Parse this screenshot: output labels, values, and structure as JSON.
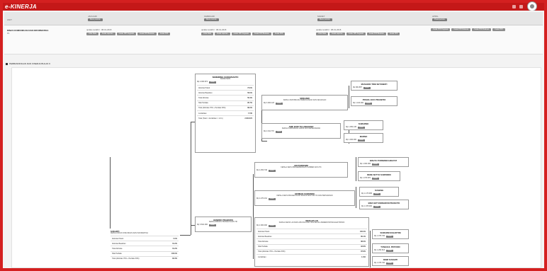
{
  "app": {
    "brand": "e-KINERJA"
  },
  "header": {
    "unit_label": "UNIT",
    "columns": [
      {
        "label": "JANUARI",
        "action": "Menu periode"
      },
      {
        "label": "FEBRUARI",
        "action": "Menu periode"
      },
      {
        "label": "MARET",
        "action": "Menu periode"
      },
      {
        "label": "APRIL",
        "action": "Pusat periode"
      }
    ]
  },
  "org": {
    "name": "DINAS KOMUNIKASI DAN INFORMATIKA",
    "sub": "P1",
    "columns": [
      {
        "updated": "update terakhir : 08-01-2018",
        "buttons": [
          "Lihat Data",
          "Cetak Laporan",
          "Cetak TPP Pegawai",
          "Cetak TPP Bulanan",
          "Cetak TPP"
        ]
      },
      {
        "updated": "update terakhir : 08-01-2018",
        "buttons": [
          "Lihat Data",
          "Cetak Laporan",
          "Cetak TPP Pegawai",
          "Cetak TPP Bulanan",
          "Cetak TPP"
        ]
      },
      {
        "updated": "update terakhir : 08-01-2018",
        "buttons": [
          "Lihat Data",
          "Cetak Laporan",
          "Cetak TPP Pegawai",
          "Cetak TPP Bulanan",
          "Cetak TPP"
        ]
      },
      {
        "updated": "",
        "buttons": [
          "Cetak TPP Pegawai",
          "Cetak TPP Bulanan",
          "Cetak TPP Bulanan",
          "Cetak TPP"
        ]
      }
    ]
  },
  "section": {
    "title": "PERBANDINGAN DAN KINERJA BULAN 9"
  },
  "nodes": {
    "kadis": {
      "title": "SUKARTI",
      "role": "KEPALA DINAS KOMUNIKASI DAN INFORMATIKA",
      "rows": [
        {
          "k": "Aktivitas Pokok",
          "v": "0.0%"
        },
        {
          "k": "Aktivitas Bawahan",
          "v": "61.2%"
        },
        {
          "k": "Total Aktivitas",
          "v": "61.2%"
        },
        {
          "k": "Nilai Perilaku",
          "v": "100.0%"
        },
        {
          "k": "Total (Aktivitas 70% + Perilaku 30%)",
          "v": "82.3%"
        }
      ]
    },
    "sek": {
      "title": "SEMBIRING SUWARSANTO",
      "role": "SEKRETARIS",
      "tpp": "Rp 2.000.874",
      "rows": [
        {
          "k": "Aktivitas Pokok",
          "v": "74.0%"
        },
        {
          "k": "Aktivitas Bawahan",
          "v": "56.0%"
        },
        {
          "k": "Total Aktivitas",
          "v": "56.4%"
        },
        {
          "k": "Nilai Perilaku",
          "v": "95.7%"
        },
        {
          "k": "Total (Aktivitas 70% + Perilaku 30%)",
          "v": "68.2%"
        },
        {
          "k": "Jumlahkan",
          "v": "7.730"
        },
        {
          "k": "Total (Total × Jumlahkan × 1.0 k)",
          "v": "2.000.874"
        }
      ]
    },
    "kabid1": {
      "title": "HENDRO PRABOWO",
      "role": "KEPALA BIDANG PENGELOLAAN TIK",
      "tpp": "Rp 3.601.000"
    },
    "sub1": {
      "title": "SRIKANDI",
      "role": "KEPALA SUB BIDANG PERENCANAAN DAN KEUANGAN",
      "tpp": "Rp 3.000.123"
    },
    "sub2": {
      "title": "ARIF BUDI TULANGGENO",
      "role": "KEPALA SUB BIDANG UMUM DAN KEPEGAWAIAN",
      "tpp": "Rp 2.011.770"
    },
    "st1": {
      "title": "MASLENO TRIE SETIAWATI",
      "tpp": "Rp 900.887"
    },
    "st2": {
      "title": "PRANA JAYA PRASETIO",
      "tpp": "Rp 1.100.000"
    },
    "st3": {
      "title": "SUMARNO",
      "tpp": "Rp 1.050.145"
    },
    "st4": {
      "title": "MARNO",
      "tpp": "Rp 1.000.000"
    },
    "seksi1": {
      "title": "ADI PURNOMO",
      "role": "KEPALA SEKSI PENGEMBANGAN SUMBER DAYA TIK",
      "tpp": "Rp 2.254.740"
    },
    "seksi2": {
      "title": "HERMAN SUWONDO",
      "role": "KEPALA SEKSI PENGELOLAAN INFRASTRUKTUR TIK DAN PERSANDIAN",
      "tpp": "Rp 2.270.161"
    },
    "seksi3": {
      "title": "WEDI APLAN",
      "role": "KEPALA SEKSI LAYANAN APLIKASI DAN TATA KELOLA PEMERINTAHAN ELEKTRONIK",
      "tpp": "Rp 2.000.000",
      "rows": [
        {
          "k": "Aktivitas Pokok",
          "v": "100.0%"
        },
        {
          "k": "Aktivitas Bawahan",
          "v": "89.1%"
        },
        {
          "k": "Total Aktivitas",
          "v": "88.0%"
        },
        {
          "k": "Nilai Perilaku",
          "v": "92.8%"
        },
        {
          "k": "Total (Aktivitas 70% + Perilaku 30%)",
          "v": "87.8%"
        },
        {
          "k": "Jumlahkan",
          "v": "1.010"
        }
      ]
    },
    "st5": {
      "title": "WAHYU PURNOMO HIDAYAT",
      "tpp": "Rp 1.000.000"
    },
    "st6": {
      "title": "DEDE SETYO SUWONDO",
      "tpp": "Rp 1.070.870"
    },
    "st7": {
      "title": "SUGENG",
      "tpp": "Rp 1.175.965"
    },
    "st8": {
      "title": "BINA SETYANINGRUM PRANOTO",
      "tpp": "Rp 1.078.000"
    },
    "st9": {
      "title": "SUMARNI SUHARTINI",
      "tpp": "Rp 1.075.745"
    },
    "st10": {
      "title": "TUNGGUL PRIYONO",
      "tpp": "Rp 1.290.613"
    },
    "st11": {
      "title": "DEWI SUSANTI",
      "tpp": "Rp 1.075.740"
    }
  },
  "node_button_label": "Detail"
}
